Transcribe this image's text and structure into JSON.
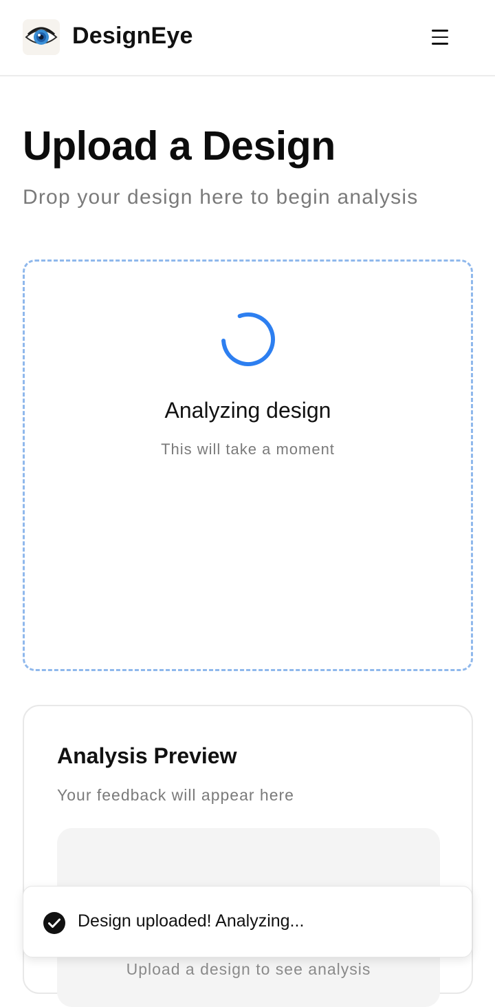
{
  "header": {
    "brand": "DesignEye",
    "logo_icon": "eye-logo-icon",
    "menu_icon": "hamburger-menu-icon"
  },
  "page": {
    "title": "Upload a Design",
    "subtitle": "Drop your design here to begin analysis"
  },
  "dropzone": {
    "status_title": "Analyzing design",
    "status_subtitle": "This will take a moment",
    "spinner_icon": "loading-spinner-icon",
    "spinner_color": "#2d7ff0",
    "border_color": "#8fb8ec"
  },
  "preview": {
    "title": "Analysis Preview",
    "subtitle": "Your feedback will appear here",
    "empty_text": "Upload a design to see analysis"
  },
  "toast": {
    "icon": "check-circle-icon",
    "message": "Design uploaded! Analyzing..."
  }
}
